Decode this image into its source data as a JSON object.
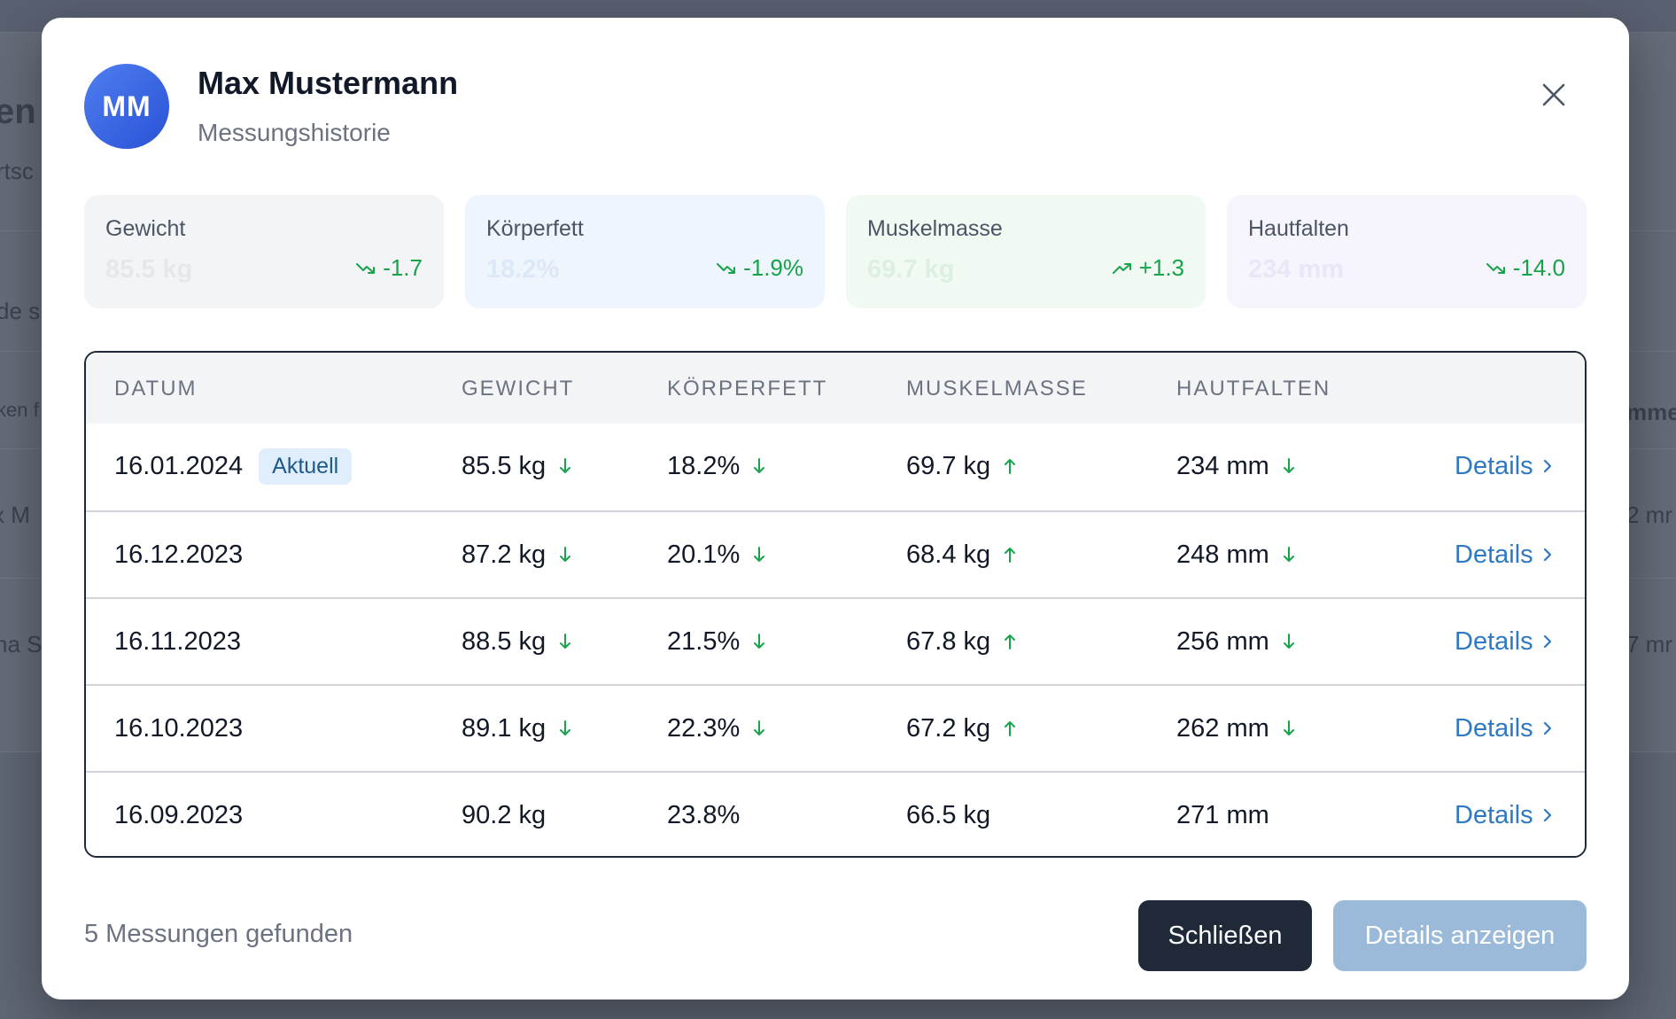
{
  "background": {
    "fragments": [
      "en",
      "rtsc",
      "de s",
      "ken f",
      "x M",
      "na S",
      "mme",
      "2 mr",
      "7 mr"
    ]
  },
  "modal": {
    "avatar_initials": "MM",
    "title": "Max Mustermann",
    "subtitle": "Messungshistorie",
    "close_icon": "close-icon"
  },
  "stats": [
    {
      "label": "Gewicht",
      "value": "85.5 kg",
      "change": "-1.7",
      "trend": "down",
      "bg": "#f3f4f6"
    },
    {
      "label": "Körperfett",
      "value": "18.2%",
      "change": "-1.9%",
      "trend": "down",
      "bg": "#eef5fd"
    },
    {
      "label": "Muskelmasse",
      "value": "69.7 kg",
      "change": "+1.3",
      "trend": "up",
      "bg": "#f0faf3"
    },
    {
      "label": "Hautfalten",
      "value": "234 mm",
      "change": "-14.0",
      "trend": "down",
      "bg": "#f6f5fd"
    }
  ],
  "table": {
    "headers": [
      "DATUM",
      "GEWICHT",
      "KÖRPERFETT",
      "MUSKELMASSE",
      "HAUTFALTEN"
    ],
    "current_badge": "Aktuell",
    "details_label": "Details",
    "rows": [
      {
        "date": "16.01.2024",
        "gewicht": "85.5 kg",
        "koerperfett": "18.2%",
        "muskelmasse": "69.7 kg",
        "hautfalten": "234 mm"
      },
      {
        "date": "16.12.2023",
        "gewicht": "87.2 kg",
        "koerperfett": "20.1%",
        "muskelmasse": "68.4 kg",
        "hautfalten": "248 mm"
      },
      {
        "date": "16.11.2023",
        "gewicht": "88.5 kg",
        "koerperfett": "21.5%",
        "muskelmasse": "67.8 kg",
        "hautfalten": "256 mm"
      },
      {
        "date": "16.10.2023",
        "gewicht": "89.1 kg",
        "koerperfett": "22.3%",
        "muskelmasse": "67.2 kg",
        "hautfalten": "262 mm"
      },
      {
        "date": "16.09.2023",
        "gewicht": "90.2 kg",
        "koerperfett": "23.8%",
        "muskelmasse": "66.5 kg",
        "hautfalten": "271 mm"
      }
    ]
  },
  "footer": {
    "count_text": "5 Messungen gefunden",
    "close_label": "Schließen",
    "details_label": "Details anzeigen"
  },
  "colors": {
    "accent": "#2f78c4",
    "positive": "#16a34a",
    "dark_button": "#1f2937",
    "disabled_button": "#9bbad9"
  }
}
